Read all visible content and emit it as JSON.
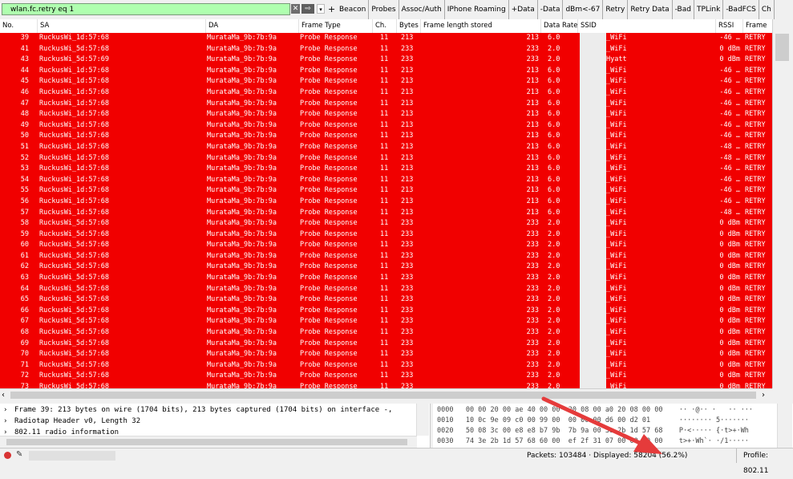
{
  "filter": {
    "value": "wlan.fc.retry eq 1",
    "apply_label": "⇨",
    "clear_label": "✕",
    "dropdown_label": "▾",
    "add_label": "+",
    "buttons": [
      "Beacon",
      "Probes",
      "Assoc/Auth",
      "IPhone Roaming",
      "+Data",
      "-Data",
      "dBm<-67",
      "Retry",
      "Retry Data",
      "-Bad",
      "TPLink",
      "-BadFCS",
      "Ch"
    ]
  },
  "columns": [
    "No.",
    "SA",
    "DA",
    "Frame Type",
    "Ch.",
    "Bytes",
    "Frame length stored",
    "Data Rate",
    "SSID",
    "RSSI",
    "Frame"
  ],
  "packets": [
    [
      "39",
      "RuckusWi_1d:57:68",
      "MurataMa_9b:7b:9a",
      "Probe Response",
      "11",
      "213",
      "213",
      "6.0",
      "_WiFi",
      "-46 …",
      "RETRY"
    ],
    [
      "41",
      "RuckusWi_5d:57:68",
      "MurataMa_9b:7b:9a",
      "Probe Response",
      "11",
      "233",
      "233",
      "2.0",
      "_WiFi",
      "0 dBm",
      "RETRY"
    ],
    [
      "43",
      "RuckusWi_5d:57:69",
      "MurataMa_9b:7b:9a",
      "Probe Response",
      "11",
      "233",
      "233",
      "2.0",
      "Hyatt",
      "0 dBm",
      "RETRY"
    ],
    [
      "44",
      "RuckusWi_1d:57:68",
      "MurataMa_9b:7b:9a",
      "Probe Response",
      "11",
      "213",
      "213",
      "6.0",
      "_WiFi",
      "-46 …",
      "RETRY"
    ],
    [
      "45",
      "RuckusWi_1d:57:68",
      "MurataMa_9b:7b:9a",
      "Probe Response",
      "11",
      "213",
      "213",
      "6.0",
      "_WiFi",
      "-46 …",
      "RETRY"
    ],
    [
      "46",
      "RuckusWi_1d:57:68",
      "MurataMa_9b:7b:9a",
      "Probe Response",
      "11",
      "213",
      "213",
      "6.0",
      "_WiFi",
      "-46 …",
      "RETRY"
    ],
    [
      "47",
      "RuckusWi_1d:57:68",
      "MurataMa_9b:7b:9a",
      "Probe Response",
      "11",
      "213",
      "213",
      "6.0",
      "_WiFi",
      "-46 …",
      "RETRY"
    ],
    [
      "48",
      "RuckusWi_1d:57:68",
      "MurataMa_9b:7b:9a",
      "Probe Response",
      "11",
      "213",
      "213",
      "6.0",
      "_WiFi",
      "-46 …",
      "RETRY"
    ],
    [
      "49",
      "RuckusWi_1d:57:68",
      "MurataMa_9b:7b:9a",
      "Probe Response",
      "11",
      "213",
      "213",
      "6.0",
      "_WiFi",
      "-46 …",
      "RETRY"
    ],
    [
      "50",
      "RuckusWi_1d:57:68",
      "MurataMa_9b:7b:9a",
      "Probe Response",
      "11",
      "213",
      "213",
      "6.0",
      "_WiFi",
      "-46 …",
      "RETRY"
    ],
    [
      "51",
      "RuckusWi_1d:57:68",
      "MurataMa_9b:7b:9a",
      "Probe Response",
      "11",
      "213",
      "213",
      "6.0",
      "_WiFi",
      "-48 …",
      "RETRY"
    ],
    [
      "52",
      "RuckusWi_1d:57:68",
      "MurataMa_9b:7b:9a",
      "Probe Response",
      "11",
      "213",
      "213",
      "6.0",
      "_WiFi",
      "-48 …",
      "RETRY"
    ],
    [
      "53",
      "RuckusWi_1d:57:68",
      "MurataMa_9b:7b:9a",
      "Probe Response",
      "11",
      "213",
      "213",
      "6.0",
      "_WiFi",
      "-46 …",
      "RETRY"
    ],
    [
      "54",
      "RuckusWi_1d:57:68",
      "MurataMa_9b:7b:9a",
      "Probe Response",
      "11",
      "213",
      "213",
      "6.0",
      "_WiFi",
      "-46 …",
      "RETRY"
    ],
    [
      "55",
      "RuckusWi_1d:57:68",
      "MurataMa_9b:7b:9a",
      "Probe Response",
      "11",
      "213",
      "213",
      "6.0",
      "_WiFi",
      "-46 …",
      "RETRY"
    ],
    [
      "56",
      "RuckusWi_1d:57:68",
      "MurataMa_9b:7b:9a",
      "Probe Response",
      "11",
      "213",
      "213",
      "6.0",
      "_WiFi",
      "-46 …",
      "RETRY"
    ],
    [
      "57",
      "RuckusWi_1d:57:68",
      "MurataMa_9b:7b:9a",
      "Probe Response",
      "11",
      "213",
      "213",
      "6.0",
      "_WiFi",
      "-48 …",
      "RETRY"
    ],
    [
      "58",
      "RuckusWi_5d:57:68",
      "MurataMa_9b:7b:9a",
      "Probe Response",
      "11",
      "233",
      "233",
      "2.0",
      "_WiFi",
      "0 dBm",
      "RETRY"
    ],
    [
      "59",
      "RuckusWi_5d:57:68",
      "MurataMa_9b:7b:9a",
      "Probe Response",
      "11",
      "233",
      "233",
      "2.0",
      "_WiFi",
      "0 dBm",
      "RETRY"
    ],
    [
      "60",
      "RuckusWi_5d:57:68",
      "MurataMa_9b:7b:9a",
      "Probe Response",
      "11",
      "233",
      "233",
      "2.0",
      "_WiFi",
      "0 dBm",
      "RETRY"
    ],
    [
      "61",
      "RuckusWi_5d:57:68",
      "MurataMa_9b:7b:9a",
      "Probe Response",
      "11",
      "233",
      "233",
      "2.0",
      "_WiFi",
      "0 dBm",
      "RETRY"
    ],
    [
      "62",
      "RuckusWi_5d:57:68",
      "MurataMa_9b:7b:9a",
      "Probe Response",
      "11",
      "233",
      "233",
      "2.0",
      "_WiFi",
      "0 dBm",
      "RETRY"
    ],
    [
      "63",
      "RuckusWi_5d:57:68",
      "MurataMa_9b:7b:9a",
      "Probe Response",
      "11",
      "233",
      "233",
      "2.0",
      "_WiFi",
      "0 dBm",
      "RETRY"
    ],
    [
      "64",
      "RuckusWi_5d:57:68",
      "MurataMa_9b:7b:9a",
      "Probe Response",
      "11",
      "233",
      "233",
      "2.0",
      "_WiFi",
      "0 dBm",
      "RETRY"
    ],
    [
      "65",
      "RuckusWi_5d:57:68",
      "MurataMa_9b:7b:9a",
      "Probe Response",
      "11",
      "233",
      "233",
      "2.0",
      "_WiFi",
      "0 dBm",
      "RETRY"
    ],
    [
      "66",
      "RuckusWi_5d:57:68",
      "MurataMa_9b:7b:9a",
      "Probe Response",
      "11",
      "233",
      "233",
      "2.0",
      "_WiFi",
      "0 dBm",
      "RETRY"
    ],
    [
      "67",
      "RuckusWi_5d:57:68",
      "MurataMa_9b:7b:9a",
      "Probe Response",
      "11",
      "233",
      "233",
      "2.0",
      "_WiFi",
      "0 dBm",
      "RETRY"
    ],
    [
      "68",
      "RuckusWi_5d:57:68",
      "MurataMa_9b:7b:9a",
      "Probe Response",
      "11",
      "233",
      "233",
      "2.0",
      "_WiFi",
      "0 dBm",
      "RETRY"
    ],
    [
      "69",
      "RuckusWi_5d:57:68",
      "MurataMa_9b:7b:9a",
      "Probe Response",
      "11",
      "233",
      "233",
      "2.0",
      "_WiFi",
      "0 dBm",
      "RETRY"
    ],
    [
      "70",
      "RuckusWi_5d:57:68",
      "MurataMa_9b:7b:9a",
      "Probe Response",
      "11",
      "233",
      "233",
      "2.0",
      "_WiFi",
      "0 dBm",
      "RETRY"
    ],
    [
      "71",
      "RuckusWi_5d:57:68",
      "MurataMa_9b:7b:9a",
      "Probe Response",
      "11",
      "233",
      "233",
      "2.0",
      "_WiFi",
      "0 dBm",
      "RETRY"
    ],
    [
      "72",
      "RuckusWi_5d:57:68",
      "MurataMa_9b:7b:9a",
      "Probe Response",
      "11",
      "233",
      "233",
      "2.0",
      "_WiFi",
      "0 dBm",
      "RETRY"
    ],
    [
      "73",
      "RuckusWi_5d:57:68",
      "MurataMa_9b:7b:9a",
      "Probe Response",
      "11",
      "233",
      "233",
      "2.0",
      "_WiFi",
      "0 dBm",
      "RETRY"
    ]
  ],
  "details": [
    "Frame 39: 213 bytes on wire (1704 bits), 213 bytes captured (1704 bits) on interface -,",
    "Radiotap Header v0, Length 32",
    "802.11 radio information"
  ],
  "bytes": [
    "0000   00 00 20 00 ae 40 00 00  20 08 00 a0 20 08 00 00    ·· ·@·· ·   ·· ···",
    "0010   10 0c 9e 09 c0 00 99 00  00 00 00 d6 00 d2 01       ········ 5·······",
    "0020   50 08 3c 00 e8 e8 b7 9b  7b 9a 00 3e 2b 1d 57 68    P·<····· {·t>+·Wh",
    "0030   74 3e 2b 1d 57 68 60 00  ef 2f 31 07 00 00 00 00    t>+·Wh`· ·/1·····"
  ],
  "status": {
    "packets_text": "Packets: 103484 · Displayed: 58204 (56.2%)",
    "profile_text": "Profile: 802.11"
  },
  "colors": {
    "row_bg": "#f10000",
    "row_fg": "#ffffff",
    "filter_bg": "#afffaf",
    "annotation_arrow": "#e53b3b"
  }
}
